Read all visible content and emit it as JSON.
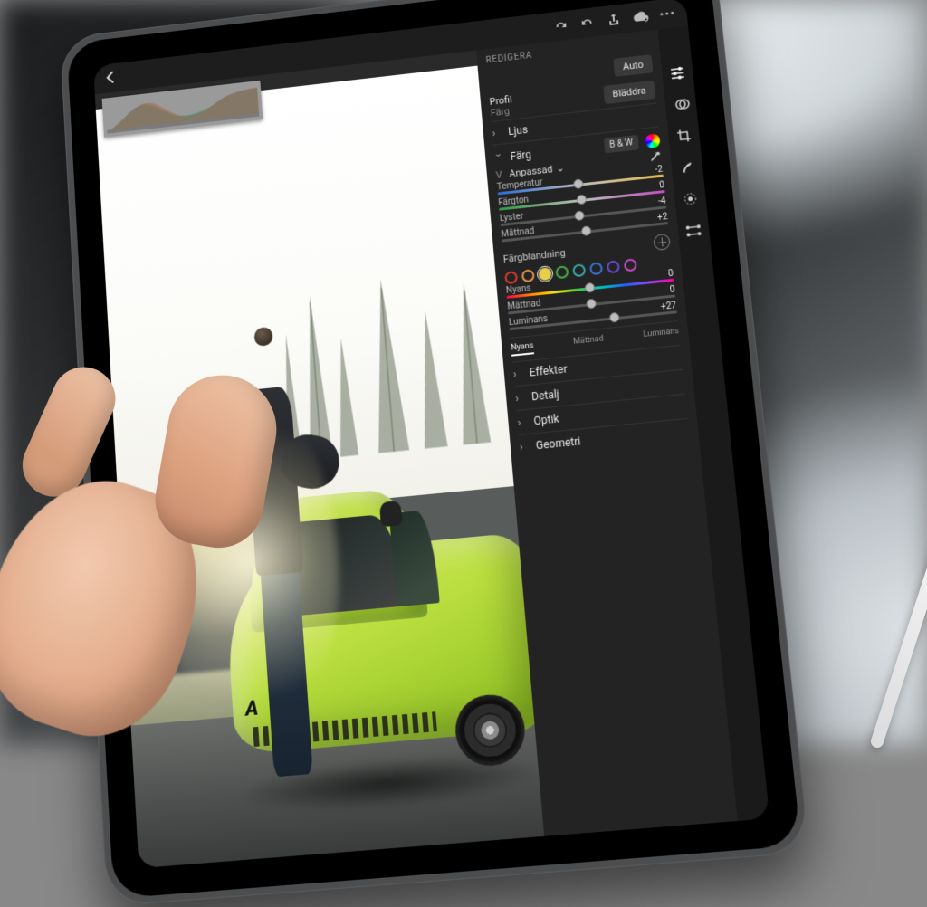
{
  "header": {
    "panel_title": "REDIGERA",
    "auto_label": "Auto"
  },
  "profile": {
    "label": "Profil",
    "value": "Färg",
    "browse_label": "Bläddra"
  },
  "sections": {
    "light": "Ljus",
    "color": "Färg",
    "effects": "Effekter",
    "detail": "Detalj",
    "optics": "Optik",
    "geometry": "Geometri"
  },
  "color": {
    "bw_label": "B & W",
    "wb_label": "V",
    "wb_value": "Anpassad",
    "sliders": {
      "temperature": {
        "label": "Temperatur",
        "value": "-2",
        "pos": 49
      },
      "tint": {
        "label": "Färgton",
        "value": "0",
        "pos": 50
      },
      "vibrance": {
        "label": "Lyster",
        "value": "-4",
        "pos": 48
      },
      "saturation": {
        "label": "Mättnad",
        "value": "+2",
        "pos": 51
      }
    },
    "mix": {
      "title": "Färgblandning",
      "swatches": [
        "#e03a2a",
        "#e8954a",
        "#e8cf4a",
        "#4aae4a",
        "#3aa7a7",
        "#3a74d6",
        "#6a4ad6",
        "#c14acb"
      ],
      "selected": 2,
      "hue": {
        "label": "Nyans",
        "value": "0",
        "pos": 50
      },
      "sat": {
        "label": "Mättnad",
        "value": "0",
        "pos": 50
      },
      "luminance": {
        "label": "Luminans",
        "value": "+27",
        "pos": 63
      },
      "tabs": {
        "hue": "Nyans",
        "sat": "Mättnad",
        "lum": "Luminans",
        "active": "hue"
      }
    }
  },
  "car_badge": "A"
}
